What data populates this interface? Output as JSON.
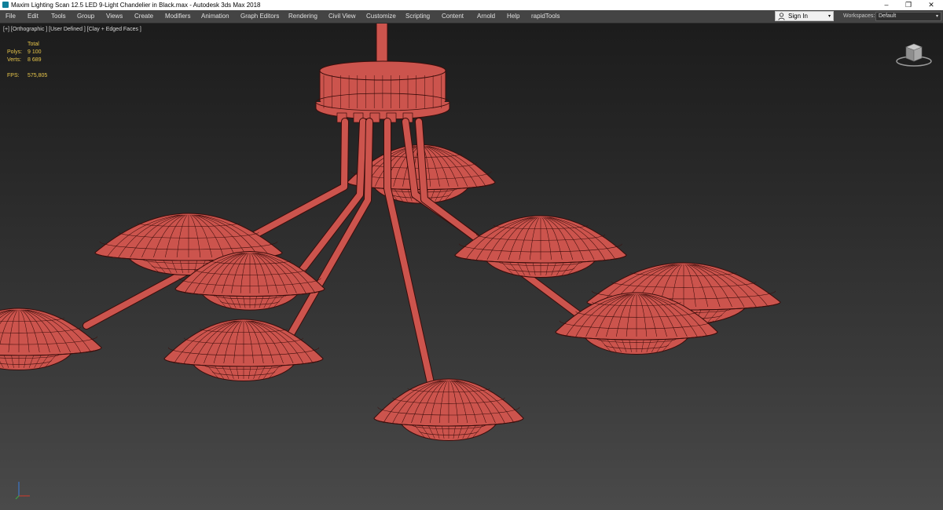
{
  "window": {
    "title": "Maxim Lighting Scan 12.5 LED 9-Light Chandelier in Black.max - Autodesk 3ds Max 2018",
    "app_icon": "3ds-max-icon",
    "controls": {
      "minimize": "–",
      "maximize": "❐",
      "close": "✕"
    }
  },
  "menubar": {
    "items": [
      "File",
      "Edit",
      "Tools",
      "Group",
      "Views",
      "Create",
      "Modifiers",
      "Animation",
      "Graph Editors",
      "Rendering",
      "Civil View",
      "Customize",
      "Scripting",
      "Content",
      "Arnold",
      "Help",
      "rapidTools"
    ],
    "sign_in": {
      "label": "Sign In",
      "icon": "user-icon",
      "caret": "▾"
    },
    "workspace": {
      "label": "Workspaces:",
      "value": "Default",
      "caret": "▾"
    }
  },
  "viewport": {
    "label": "[+] [Orthographic ] [User Defined ] [Clay + Edged Faces ]",
    "stats": {
      "total_label": "Total",
      "polys_label": "Polys:",
      "polys_value": "9 100",
      "verts_label": "Verts:",
      "verts_value": "8 689",
      "fps_label": "FPS:",
      "fps_value": "575,805"
    },
    "clay_color": "#cc544d",
    "edge_color": "#3a0d0b"
  }
}
